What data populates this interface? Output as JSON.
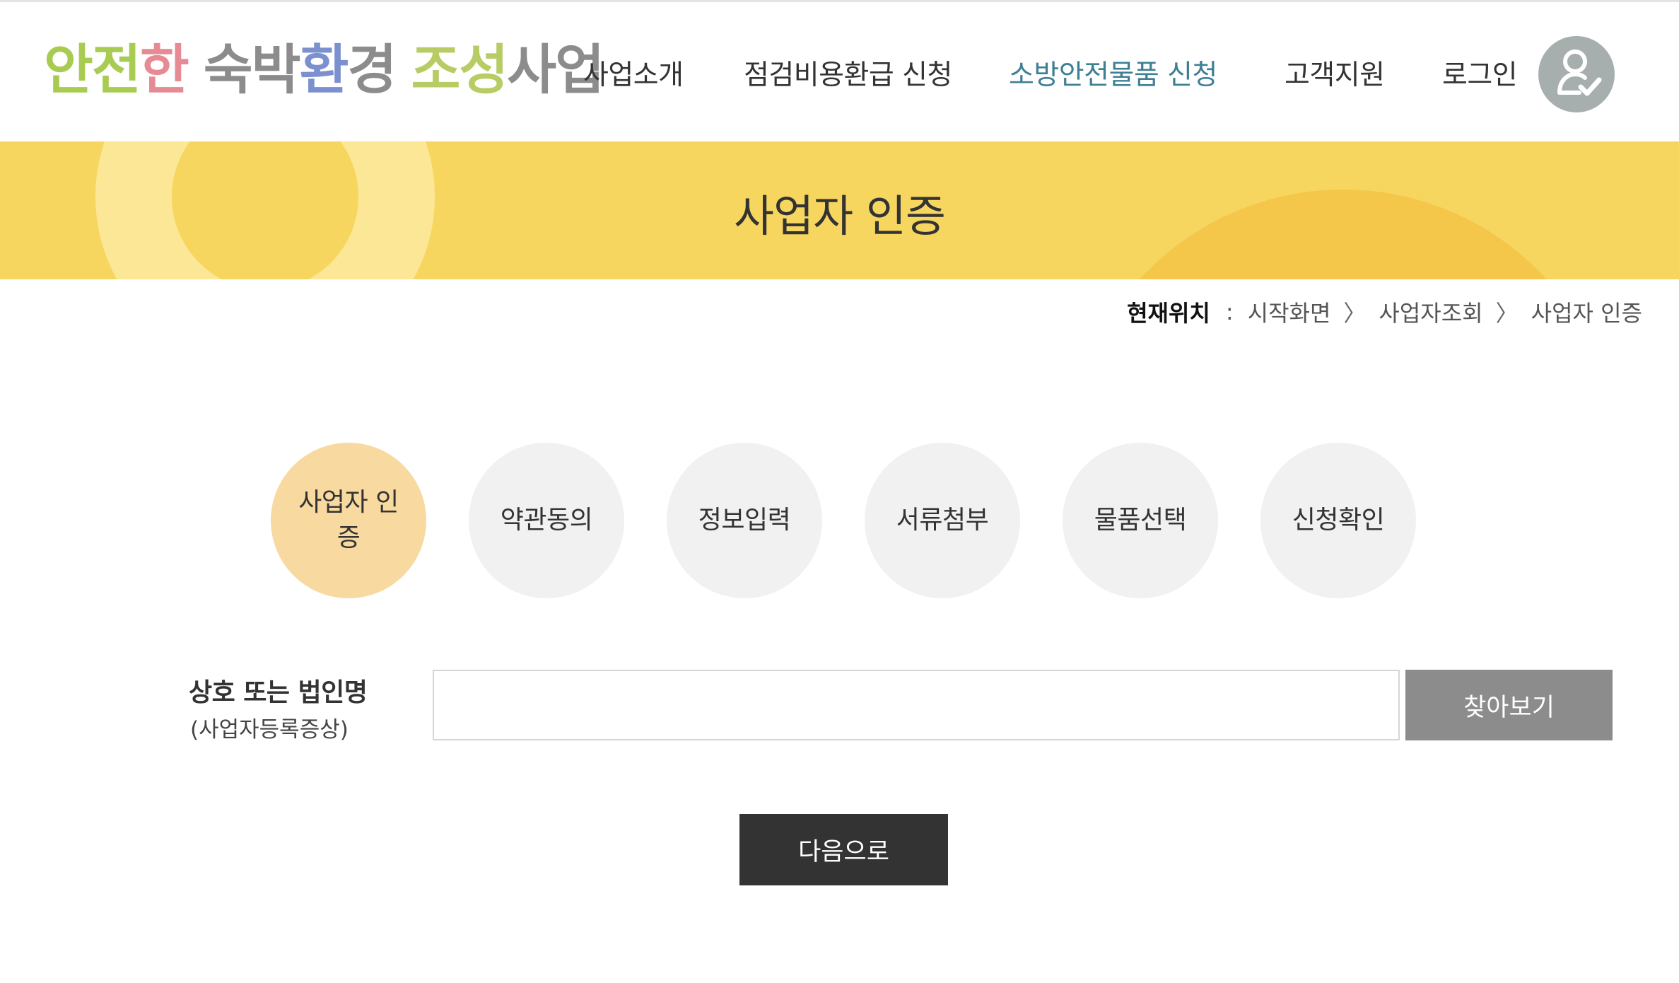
{
  "header": {
    "logo": [
      {
        "text": "안전",
        "color": "#a8cc52"
      },
      {
        "text": "한",
        "color": "#e68a93"
      },
      {
        "text": " ",
        "color": "#ffffff"
      },
      {
        "text": "숙박",
        "color": "#8c8c8c"
      },
      {
        "text": "환",
        "color": "#7c90cf"
      },
      {
        "text": "경",
        "color": "#8c8c8c"
      },
      {
        "text": " ",
        "color": "#ffffff"
      },
      {
        "text": "조성",
        "color": "#b8cc66"
      },
      {
        "text": "사업",
        "color": "#8c8c8c"
      }
    ],
    "nav": [
      {
        "label": "사업소개",
        "active": false
      },
      {
        "label": "점검비용환급 신청",
        "active": false
      },
      {
        "label": "소방안전물품 신청",
        "active": true
      },
      {
        "label": "고객지원",
        "active": false
      }
    ],
    "login_label": "로그인",
    "user_icon": "user-check-icon"
  },
  "banner": {
    "title": "사업자 인증"
  },
  "breadcrumb": {
    "label": "현재위치",
    "colon": ":",
    "items": [
      "시작화면",
      "사업자조회",
      "사업자 인증"
    ]
  },
  "steps": [
    {
      "label": "사업자 인증",
      "active": true
    },
    {
      "label": "약관동의",
      "active": false
    },
    {
      "label": "정보입력",
      "active": false
    },
    {
      "label": "서류첨부",
      "active": false
    },
    {
      "label": "물품선택",
      "active": false
    },
    {
      "label": "신청확인",
      "active": false
    }
  ],
  "form": {
    "label": "상호 또는 법인명",
    "sublabel": "(사업자등록증상)",
    "value": "",
    "placeholder": "",
    "search_label": "찾아보기"
  },
  "actions": {
    "next_label": "다음으로"
  },
  "colors": {
    "accent_nav": "#3f7f94",
    "banner": "#f7d660",
    "step_active": "#f8d9a0",
    "step_inactive": "#f1f1f1",
    "search_button": "#8c8c8c",
    "next_button": "#333333"
  }
}
